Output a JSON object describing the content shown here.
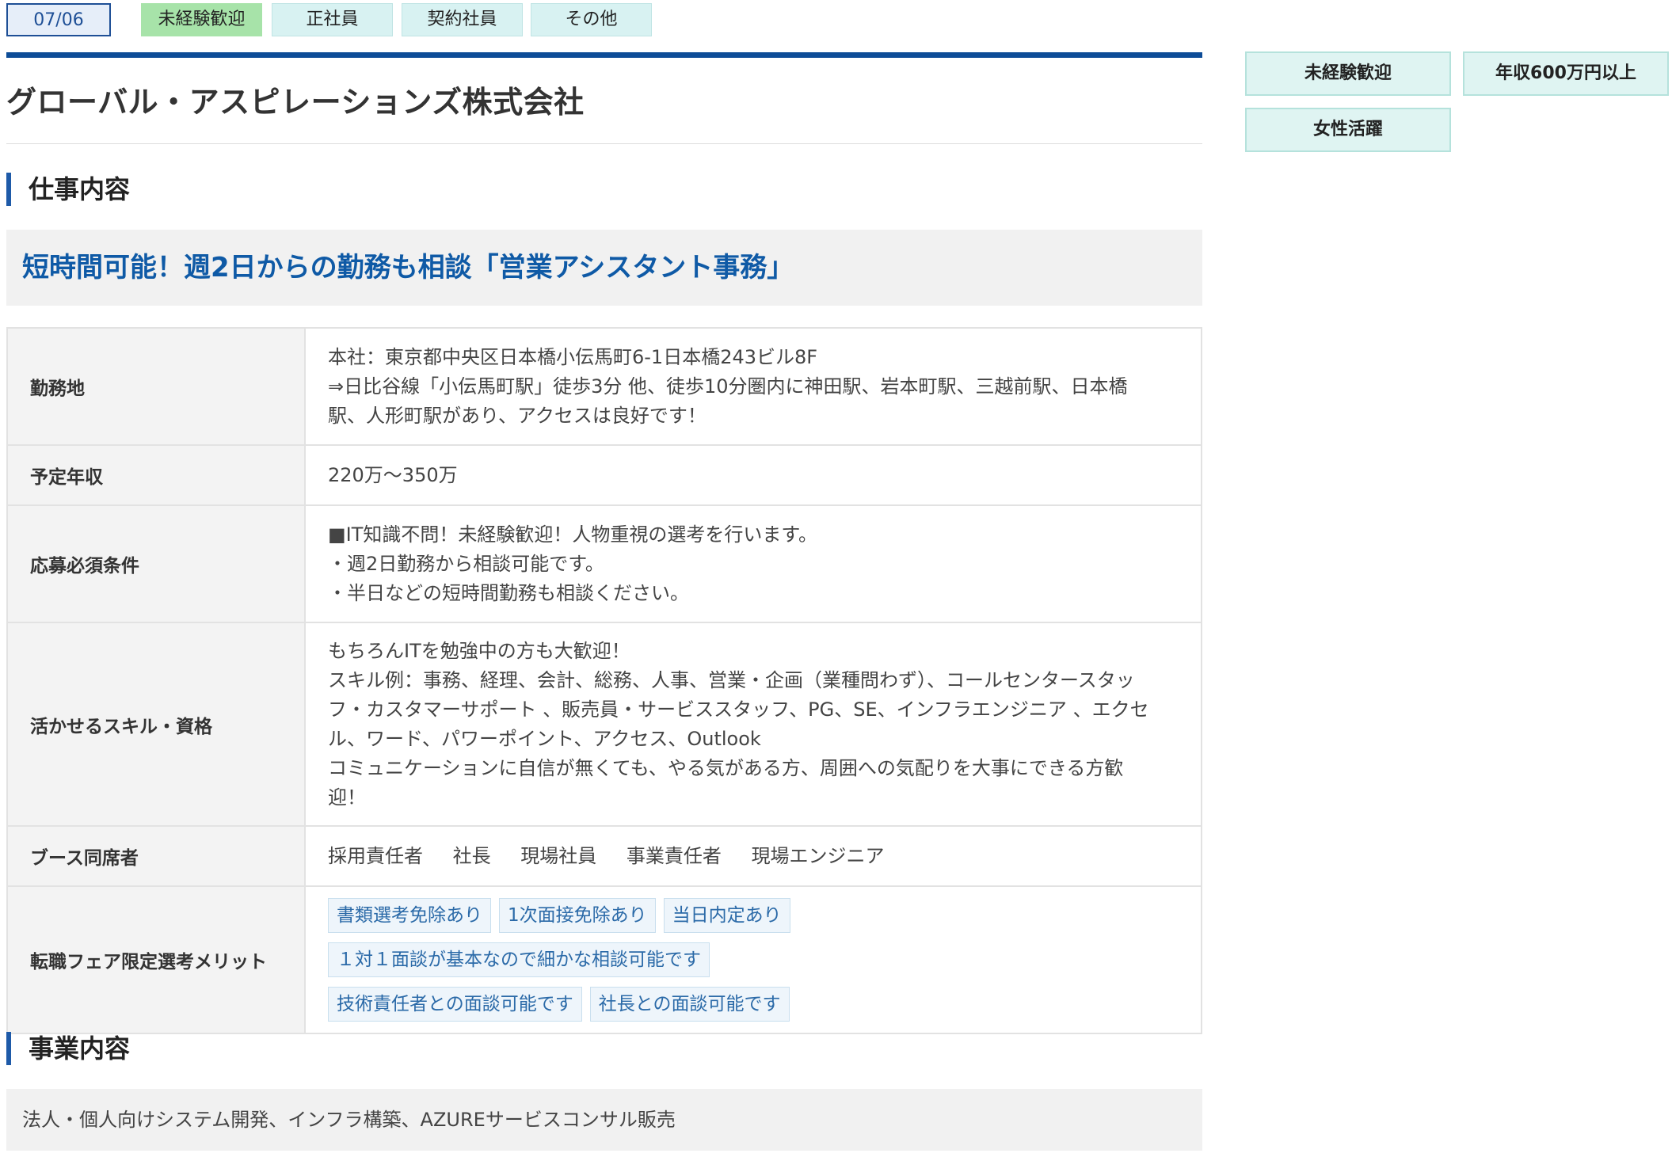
{
  "top_tags": {
    "date": "07/06",
    "tags": [
      "未経験歓迎",
      "正社員",
      "契約社員",
      "その他"
    ]
  },
  "company_name": "グローバル・アスピレーションズ株式会社",
  "job_section": {
    "heading": "仕事内容",
    "catch_copy": "短時間可能！週2日からの勤務も相談「営業アシスタント事務」"
  },
  "details": {
    "location_label": "勤務地",
    "location_lines": [
      "本社：東京都中央区日本橋小伝馬町6-1日本橋243ビル8F",
      "⇒日比谷線「小伝馬町駅」徒歩3分 他、徒歩10分圏内に神田駅、岩本町駅、三越前駅、日本橋",
      "駅、人形町駅があり、アクセスは良好です！"
    ],
    "salary_label": "予定年収",
    "salary_value": "220万～350万",
    "requirements_label": "応募必須条件",
    "requirements_lines": [
      "■IT知識不問！未経験歓迎！人物重視の選考を行います。",
      "・週2日勤務から相談可能です。",
      "・半日などの短時間勤務も相談ください。"
    ],
    "skills_label": "活かせるスキル・資格",
    "skills_lines": [
      "もちろんITを勉強中の方も大歓迎！",
      "スキル例：事務、経理、会計、総務、人事、営業・企画（業種問わず）、コールセンタースタッ",
      "フ・カスタマーサポート 、販売員・サービススタッフ、PG、SE、インフラエンジニア 、エクセ",
      "ル、ワード、パワーポイント、アクセス、Outlook",
      "コミュニケーションに自信が無くても、やる気がある方、周囲への気配りを大事にできる方歓",
      "迎！"
    ],
    "booth_label": "ブース同席者",
    "booth_members": [
      "採用責任者",
      "社長",
      "現場社員",
      "事業責任者",
      "現場エンジニア"
    ],
    "merits_label": "転職フェア限定選考メリット",
    "merits": [
      "書類選考免除あり",
      "1次面接免除あり",
      "当日内定あり",
      "１対１面談が基本なので細かな相談可能です",
      "技術責任者との面談可能です",
      "社長との面談可能です"
    ]
  },
  "business_section": {
    "heading": "事業内容",
    "text": "法人・個人向けシステム開発、インフラ構築、AZUREサービスコンサル販売"
  },
  "side_tags": [
    "未経験歓迎",
    "年収600万円以上",
    "女性活躍"
  ],
  "colors": {
    "brand_blue": "#0d4c97",
    "catch_text": "#0f5aa6",
    "green_tag": "#a7e3a9",
    "mint_tag": "#d8f2f2"
  }
}
